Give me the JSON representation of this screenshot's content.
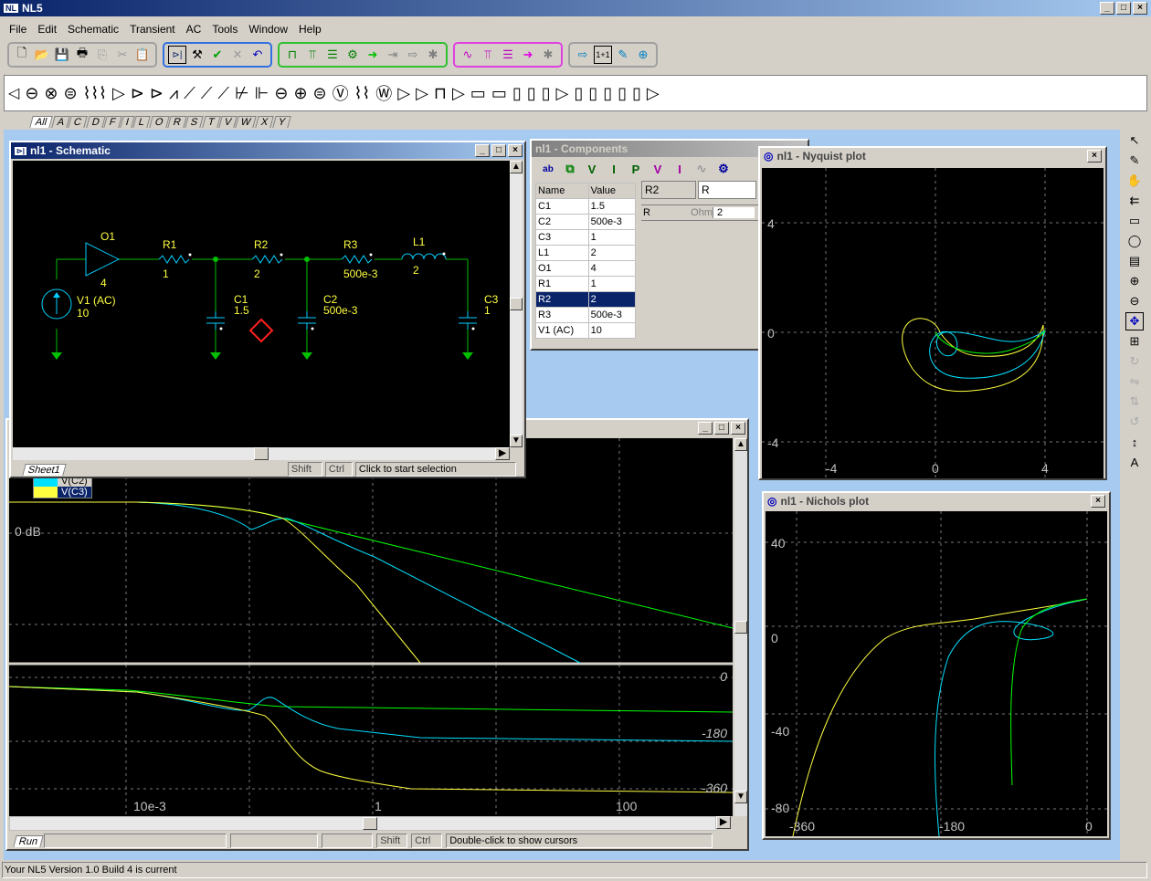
{
  "app": {
    "title": "NL5"
  },
  "menu": [
    "File",
    "Edit",
    "Schematic",
    "Transient",
    "AC",
    "Tools",
    "Window",
    "Help"
  ],
  "component_tabs": [
    "All",
    "A",
    "C",
    "D",
    "F",
    "I",
    "L",
    "O",
    "R",
    "S",
    "T",
    "V",
    "W",
    "X",
    "Y"
  ],
  "schematic": {
    "title": "nl1 - Schematic",
    "sheet_tab": "Sheet1",
    "status": {
      "shift": "Shift",
      "ctrl": "Ctrl",
      "message": "Click to start selection"
    },
    "labels": {
      "o1": "O1",
      "o1_val": "4",
      "v1": "V1 (AC)",
      "v1_val": "10",
      "r1": "R1",
      "r1_val": "1",
      "r2": "R2",
      "r2_val": "2",
      "r3": "R3",
      "r3_val": "500e-3",
      "l1": "L1",
      "l1_val": "2",
      "c1": "C1",
      "c1_val": "1.5",
      "c2": "C2",
      "c2_val": "500e-3",
      "c3": "C3",
      "c3_val": "1"
    }
  },
  "components": {
    "title": "nl1 - Components",
    "headers": [
      "Name",
      "Value"
    ],
    "rows": [
      [
        "C1",
        "1.5"
      ],
      [
        "C2",
        "500e-3"
      ],
      [
        "C3",
        "1"
      ],
      [
        "L1",
        "2"
      ],
      [
        "O1",
        "4"
      ],
      [
        "R1",
        "1"
      ],
      [
        "R2",
        "2"
      ],
      [
        "R3",
        "500e-3"
      ],
      [
        "V1 (AC)",
        "10"
      ]
    ],
    "selected": "R2",
    "detail_name": "R2",
    "detail_type": "R",
    "param_name": "R",
    "param_unit": "Ohm",
    "param_value": "2"
  },
  "bode": {
    "legend": [
      "V(C2)",
      "V(C3)"
    ],
    "mag_label": "0 dB",
    "phase_labels": [
      "0",
      "-180",
      "-360"
    ],
    "x_labels": [
      "10e-3",
      "1",
      "100"
    ],
    "run_tab": "Run",
    "status": {
      "shift": "Shift",
      "ctrl": "Ctrl",
      "message": "Double-click to show cursors"
    }
  },
  "nyquist": {
    "title": "nl1 - Nyquist plot",
    "y_labels": [
      "4",
      "0",
      "-4"
    ],
    "x_labels": [
      "-4",
      "0",
      "4"
    ]
  },
  "nichols": {
    "title": "nl1 - Nichols plot",
    "y_labels": [
      "40",
      "0",
      "-40",
      "-80"
    ],
    "x_labels": [
      "-360",
      "-180",
      "0"
    ]
  },
  "statusbar": {
    "text": "Your NL5 Version 1.0 Build 4 is current"
  },
  "colors": {
    "trace_c1": "#00ff00",
    "trace_c2": "#00e0ff",
    "trace_c3": "#ffff40",
    "schematic_wire": "#00c000",
    "component": "#00d0ff"
  }
}
